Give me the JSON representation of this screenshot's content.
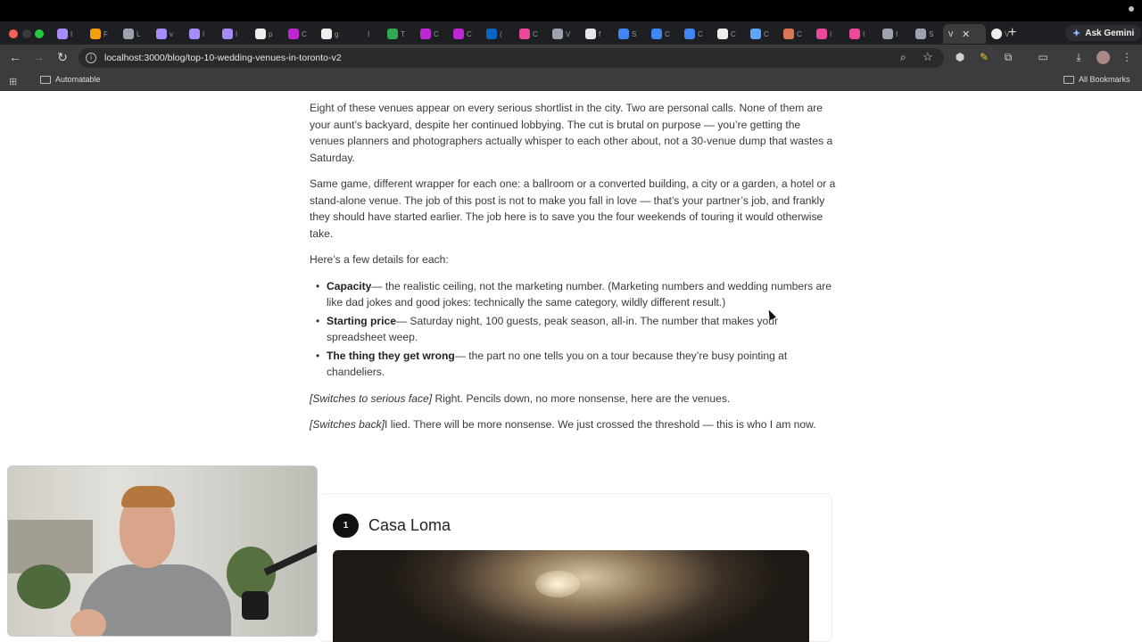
{
  "browser": {
    "tabs": [
      {
        "icon": "tab-favicon-purple",
        "color": "#a78bfa",
        "label": "I"
      },
      {
        "icon": "tab-favicon-chart",
        "color": "#f59e0b",
        "label": "F"
      },
      {
        "icon": "tab-favicon-globe",
        "color": "#9ca3af",
        "label": "L"
      },
      {
        "icon": "tab-favicon-purple",
        "color": "#a78bfa",
        "label": "v"
      },
      {
        "icon": "tab-favicon-purple",
        "color": "#a78bfa",
        "label": "I"
      },
      {
        "icon": "tab-favicon-purple",
        "color": "#a78bfa",
        "label": "I"
      },
      {
        "icon": "tab-favicon-google",
        "color": "#eeeeee",
        "label": "p"
      },
      {
        "icon": "tab-favicon-m",
        "color": "#c026d3",
        "label": "C"
      },
      {
        "icon": "tab-favicon-google",
        "color": "#eeeeee",
        "label": "g"
      },
      {
        "icon": "tab-favicon-blank",
        "color": "#1e1f22",
        "label": "I"
      },
      {
        "icon": "tab-favicon-maps",
        "color": "#34a853",
        "label": "T"
      },
      {
        "icon": "tab-favicon-m",
        "color": "#c026d3",
        "label": "C"
      },
      {
        "icon": "tab-favicon-m",
        "color": "#c026d3",
        "label": "C"
      },
      {
        "icon": "tab-favicon-linkedin",
        "color": "#0a66c2",
        "label": "("
      },
      {
        "icon": "tab-favicon-pink",
        "color": "#ec4899",
        "label": "C"
      },
      {
        "icon": "tab-favicon-globe",
        "color": "#9ca3af",
        "label": "V"
      },
      {
        "icon": "tab-favicon-sk",
        "color": "#e5e7eb",
        "label": "f"
      },
      {
        "icon": "tab-favicon-doc",
        "color": "#4285f4",
        "label": "S"
      },
      {
        "icon": "tab-favicon-doc",
        "color": "#4285f4",
        "label": "C"
      },
      {
        "icon": "tab-favicon-doc",
        "color": "#4285f4",
        "label": "C"
      },
      {
        "icon": "tab-favicon-google",
        "color": "#eeeeee",
        "label": "C"
      },
      {
        "icon": "tab-favicon-a",
        "color": "#60a5fa",
        "label": "C"
      },
      {
        "icon": "tab-favicon-claude",
        "color": "#d97757",
        "label": "C"
      },
      {
        "icon": "tab-favicon-pink",
        "color": "#ec4899",
        "label": "I"
      },
      {
        "icon": "tab-favicon-pink",
        "color": "#ec4899",
        "label": "I"
      },
      {
        "icon": "tab-favicon-globe",
        "color": "#9ca3af",
        "label": "I"
      },
      {
        "icon": "tab-favicon-globe",
        "color": "#9ca3af",
        "label": "S"
      }
    ],
    "active_tab": {
      "label": "V"
    },
    "last_tab": {
      "label": "V"
    },
    "ask_gemini": "Ask Gemini",
    "url": "localhost:3000/blog/top-10-wedding-venues-in-toronto-v2",
    "bookmarks": {
      "automatable": "Automatable",
      "all_bookmarks": "All Bookmarks"
    }
  },
  "article": {
    "p1": "Eight of these venues appear on every serious shortlist in the city. Two are personal calls. None of them are your aunt’s backyard, despite her continued lobbying. The cut is brutal on purpose — you’re getting the venues planners and photographers actually whisper to each other about, not a 30-venue dump that wastes a Saturday.",
    "p2": "Same game, different wrapper for each one: a ballroom or a converted building, a city or a garden, a hotel or a stand-alone venue. The job of this post is not to make you fall in love — that’s your partner’s job, and frankly they should have started earlier. The job here is to save you the four weekends of touring it would otherwise take.",
    "p3": "Here’s a few details for each:",
    "bullets": [
      {
        "term": "Capacity",
        "text": "— the realistic ceiling, not the marketing number. (Marketing numbers and wedding numbers are like dad jokes and good jokes: technically the same category, wildly different result.)"
      },
      {
        "term": "Starting price",
        "text": "— Saturday night, 100 guests, peak season, all-in. The number that makes your spreadsheet weep."
      },
      {
        "term": "The thing they get wrong",
        "text": "— the part no one tells you on a tour because they’re busy pointing at chandeliers."
      }
    ],
    "p4_italic": "[Switches to serious face]",
    "p4_text": " Right. Pencils down, no more nonsense, here are the venues.",
    "p5_italic": "[Switches back]",
    "p5_text": "I lied. There will be more nonsense. We just crossed the threshold — this is who I am now.",
    "venue": {
      "number": "1",
      "name": "Casa Loma"
    }
  }
}
